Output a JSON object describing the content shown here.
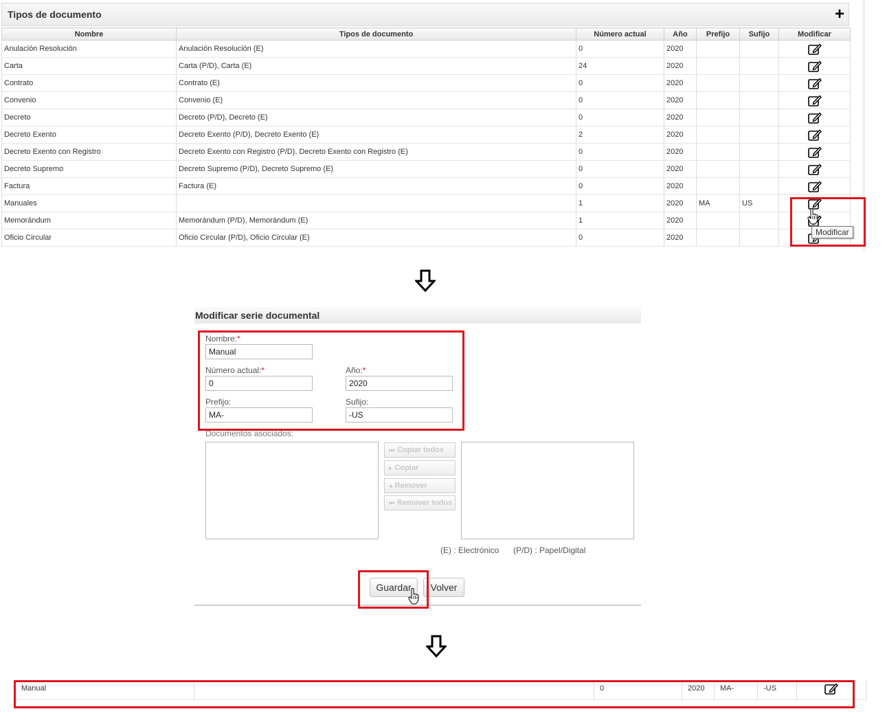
{
  "panel1": {
    "title": "Tipos de documento",
    "add_label": "+",
    "columns": [
      "Nombre",
      "Tipos de documento",
      "Número actual",
      "Año",
      "Prefijo",
      "Sufijo",
      "Modificar"
    ],
    "rows": [
      {
        "nombre": "Anulación Resolución",
        "tipos": "Anulación Resolución (E)",
        "numero": "0",
        "anio": "2020",
        "prefijo": "",
        "sufijo": ""
      },
      {
        "nombre": "Carta",
        "tipos": "Carta (P/D), Carta (E)",
        "numero": "24",
        "anio": "2020",
        "prefijo": "",
        "sufijo": ""
      },
      {
        "nombre": "Contrato",
        "tipos": "Contrato (E)",
        "numero": "0",
        "anio": "2020",
        "prefijo": "",
        "sufijo": ""
      },
      {
        "nombre": "Convenio",
        "tipos": "Convenio (E)",
        "numero": "0",
        "anio": "2020",
        "prefijo": "",
        "sufijo": ""
      },
      {
        "nombre": "Decreto",
        "tipos": "Decreto (P/D), Decreto (E)",
        "numero": "0",
        "anio": "2020",
        "prefijo": "",
        "sufijo": ""
      },
      {
        "nombre": "Decreto Exento",
        "tipos": "Decreto Exento (P/D), Decreto Exento (E)",
        "numero": "2",
        "anio": "2020",
        "prefijo": "",
        "sufijo": ""
      },
      {
        "nombre": "Decreto Exento con Registro",
        "tipos": "Decreto Exento con Registro (P/D), Decreto Exento con Registro (E)",
        "numero": "0",
        "anio": "2020",
        "prefijo": "",
        "sufijo": ""
      },
      {
        "nombre": "Decreto Supremo",
        "tipos": "Decreto Supremo (P/D), Decreto Supremo (E)",
        "numero": "0",
        "anio": "2020",
        "prefijo": "",
        "sufijo": ""
      },
      {
        "nombre": "Factura",
        "tipos": "Factura (E)",
        "numero": "0",
        "anio": "2020",
        "prefijo": "",
        "sufijo": ""
      },
      {
        "nombre": "Manuales",
        "tipos": "",
        "numero": "1",
        "anio": "2020",
        "prefijo": "MA",
        "sufijo": "US"
      },
      {
        "nombre": "Memorándum",
        "tipos": "Memorándum (P/D), Memorándum (E)",
        "numero": "1",
        "anio": "2020",
        "prefijo": "",
        "sufijo": ""
      },
      {
        "nombre": "Oficio Circular",
        "tipos": "Oficio Circular (P/D), Oficio Circular (E)",
        "numero": "0",
        "anio": "2020",
        "prefijo": "",
        "sufijo": ""
      }
    ],
    "tooltip": "Modificar"
  },
  "form": {
    "title": "Modificar serie documental",
    "nombre_label": "Nombre:",
    "nombre_value": "Manual",
    "numero_label": "Número actual:",
    "numero_value": "0",
    "anio_label": "Año:",
    "anio_value": "2020",
    "prefijo_label": "Prefijo:",
    "prefijo_value": "MA-",
    "sufijo_label": "Sufijo:",
    "sufijo_value": "-US",
    "required_mark": "*",
    "docs_label": "Documentos asociados:",
    "copy_all": "Copiar todos",
    "copy": "Copiar",
    "remove": "Remover",
    "remove_all": "Remover todos",
    "legend_e": "(E) : Electrónico",
    "legend_pd": "(P/D) : Papel/Digital",
    "save_label": "Guardar",
    "back_label": "Volver"
  },
  "result": {
    "nombre": "Manual",
    "tipos": "",
    "numero": "0",
    "anio": "2020",
    "prefijo": "MA-",
    "sufijo": "-US"
  },
  "colors": {
    "highlight": "#e0141e",
    "required": "#e0141e"
  }
}
